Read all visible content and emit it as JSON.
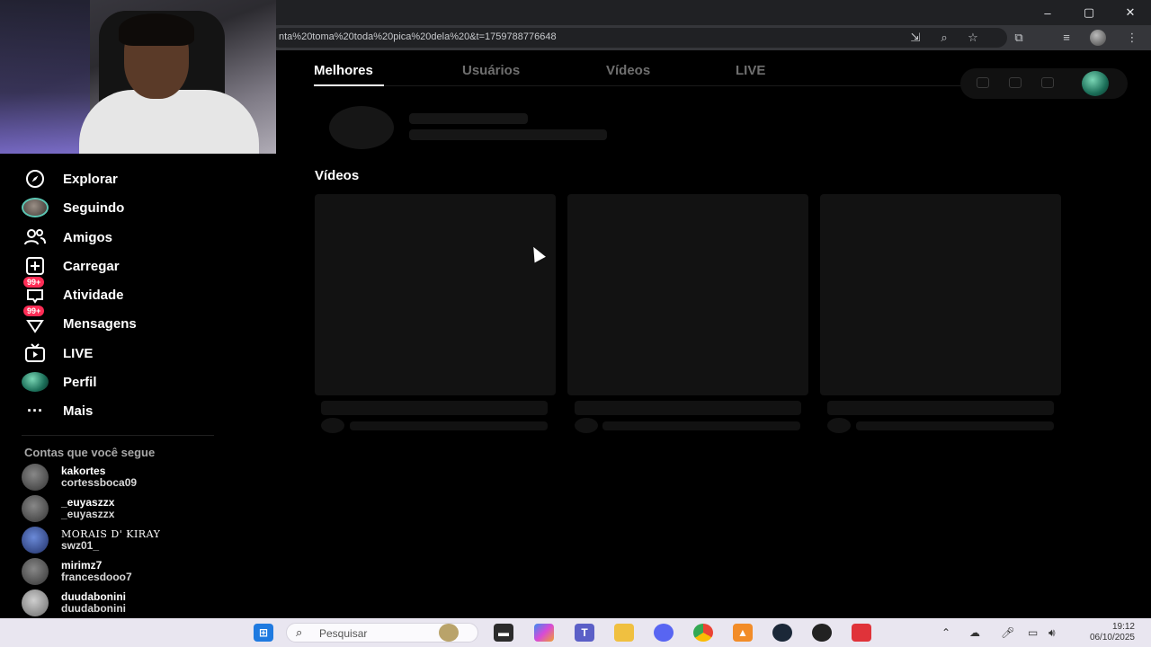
{
  "browser": {
    "url": "nta%20toma%20toda%20pica%20dela%20&t=1759788776648",
    "window_controls": [
      "–",
      "▢",
      "✕"
    ]
  },
  "tabs": {
    "items": [
      "Melhores",
      "Usuários",
      "Vídeos",
      "LIVE"
    ],
    "active": "Melhores"
  },
  "sidebar": {
    "items": [
      {
        "label": "Explorar",
        "icon": "compass-icon"
      },
      {
        "label": "Seguindo",
        "icon": "following-avatar-icon"
      },
      {
        "label": "Amigos",
        "icon": "friends-icon"
      },
      {
        "label": "Carregar",
        "icon": "upload-icon"
      },
      {
        "label": "Atividade",
        "icon": "activity-icon",
        "badge": "99+"
      },
      {
        "label": "Mensagens",
        "icon": "messages-icon",
        "badge": "99+"
      },
      {
        "label": "LIVE",
        "icon": "live-tv-icon"
      },
      {
        "label": "Perfil",
        "icon": "profile-avatar-icon"
      },
      {
        "label": "Mais",
        "icon": "more-icon"
      }
    ],
    "following_title": "Contas que você segue",
    "accounts": [
      {
        "name": "kakortes",
        "handle": "cortessboca09"
      },
      {
        "name": "_euyaszzx",
        "handle": "_euyaszzx"
      },
      {
        "name": "MORAIS D' KIRAY",
        "handle": "swz01_"
      },
      {
        "name": "mirimz7",
        "handle": "francesdooo7"
      },
      {
        "name": "duudabonini",
        "handle": "duudabonini"
      }
    ]
  },
  "main": {
    "videos_heading": "Vídeos"
  },
  "taskbar": {
    "search_placeholder": "Pesquisar",
    "time": "19:12",
    "date": "06/10/2025"
  },
  "colors": {
    "accent": "#fe2c55",
    "background": "#000000",
    "skeleton": "#121212"
  }
}
